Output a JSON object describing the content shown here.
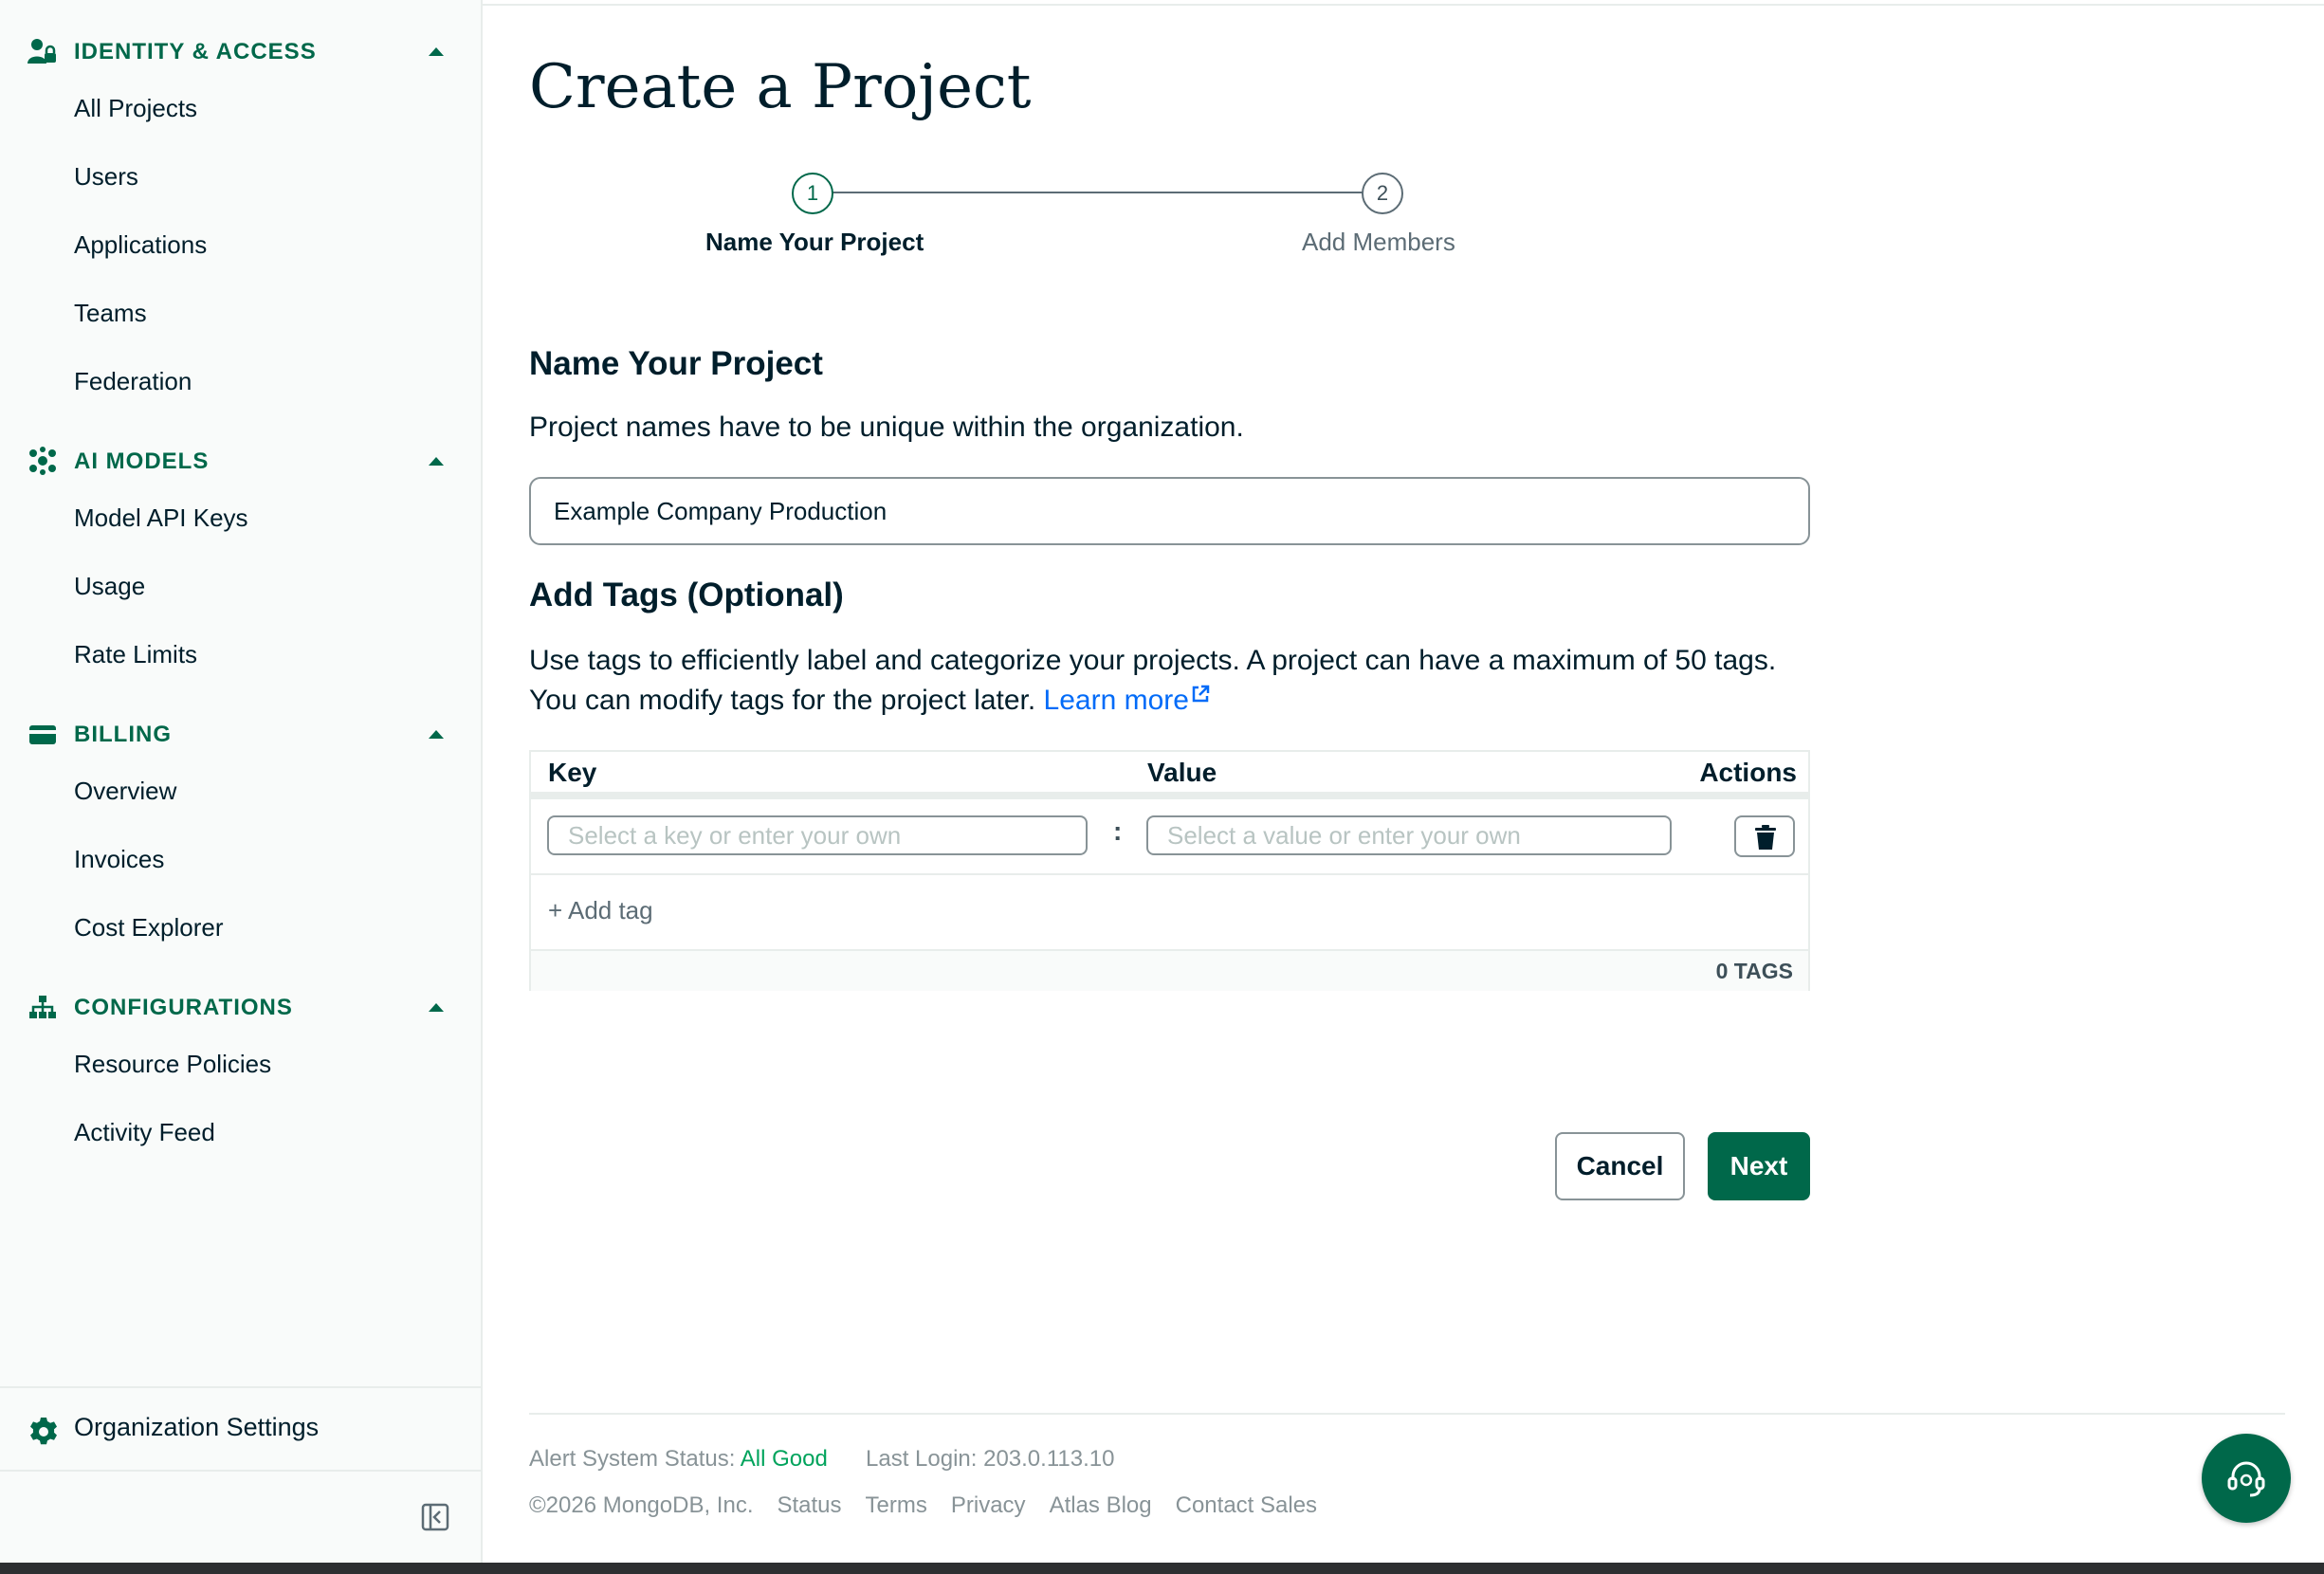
{
  "sidebar": {
    "sections": [
      {
        "title": "IDENTITY & ACCESS",
        "items": [
          "All Projects",
          "Users",
          "Applications",
          "Teams",
          "Federation"
        ]
      },
      {
        "title": "AI MODELS",
        "items": [
          "Model API Keys",
          "Usage",
          "Rate Limits"
        ]
      },
      {
        "title": "BILLING",
        "items": [
          "Overview",
          "Invoices",
          "Cost Explorer"
        ]
      },
      {
        "title": "CONFIGURATIONS",
        "items": [
          "Resource Policies",
          "Activity Feed"
        ]
      }
    ],
    "org_settings": "Organization Settings"
  },
  "page": {
    "title": "Create a Project",
    "steps": [
      {
        "number": "1",
        "label": "Name Your Project"
      },
      {
        "number": "2",
        "label": "Add Members"
      }
    ]
  },
  "name_section": {
    "heading": "Name Your Project",
    "description": "Project names have to be unique within the organization.",
    "input_value": "Example Company Production"
  },
  "tags_section": {
    "heading": "Add Tags (Optional)",
    "description": "Use tags to efficiently label and categorize your projects. A project can have a maximum of 50 tags. You can modify tags for the project later.",
    "learn_more": "Learn more",
    "columns": {
      "key": "Key",
      "value": "Value",
      "actions": "Actions"
    },
    "key_placeholder": "Select a key or enter your own",
    "value_placeholder": "Select a value or enter your own",
    "separator": ":",
    "add_tag": "+ Add tag",
    "count": "0 TAGS"
  },
  "actions": {
    "cancel": "Cancel",
    "next": "Next"
  },
  "footer": {
    "status_label": "Alert System Status:",
    "status_value": "All Good",
    "last_login": "Last Login: 203.0.113.10",
    "copyright": "©2026 MongoDB, Inc.",
    "links": [
      "Status",
      "Terms",
      "Privacy",
      "Atlas Blog",
      "Contact Sales"
    ]
  },
  "colors": {
    "brand_green": "#00684a",
    "link_blue": "#016bf8",
    "status_green": "#00a35c"
  },
  "icons": [
    "user-lock-icon",
    "ai-models-icon",
    "credit-card-icon",
    "hierarchy-icon",
    "caret-up-icon",
    "gear-icon",
    "collapse-sidebar-icon",
    "external-link-icon",
    "trash-icon",
    "support-agent-icon"
  ]
}
